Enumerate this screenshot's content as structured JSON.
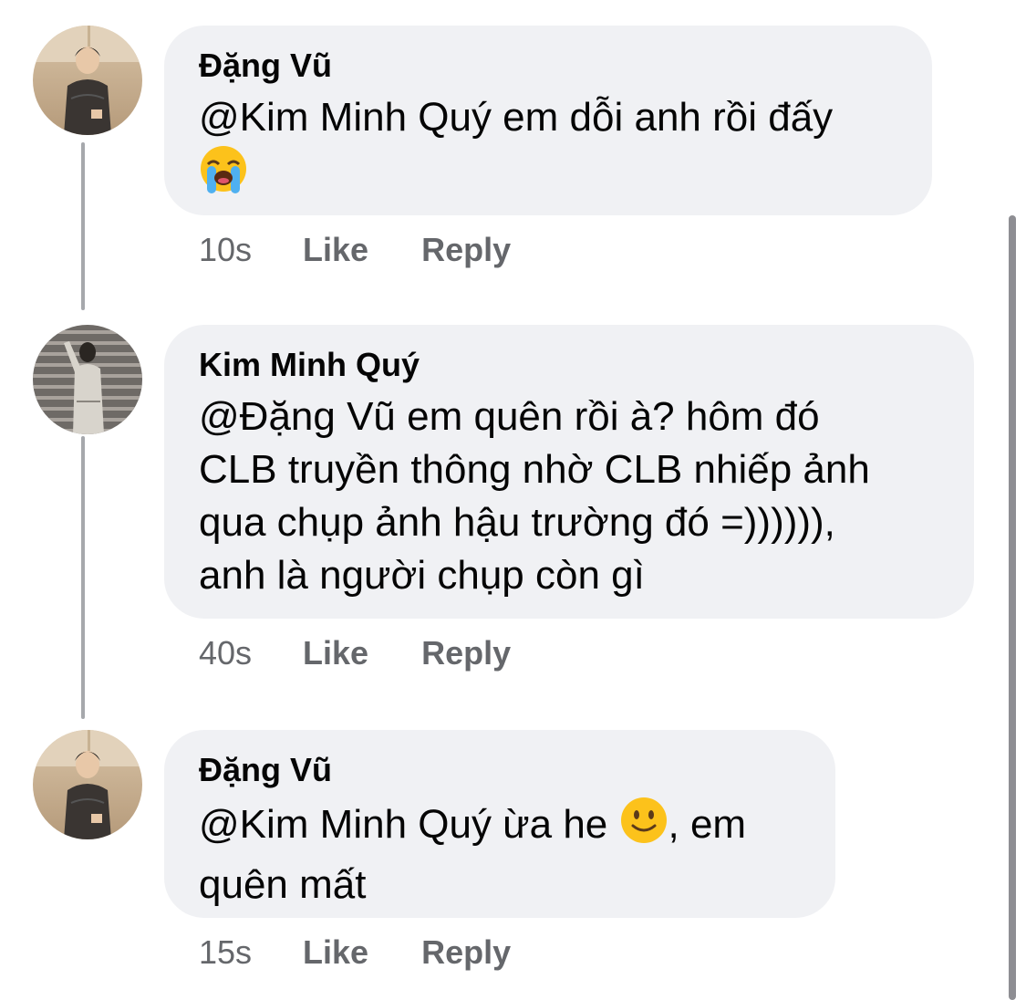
{
  "comments": [
    {
      "author": "Đặng Vũ",
      "text": "@Kim Minh Quý em dỗi anh rồi đấy",
      "emoji": "loudly-crying-face",
      "time": "10s",
      "like_label": "Like",
      "reply_label": "Reply"
    },
    {
      "author": "Kim Minh Quý",
      "text_lines": [
        "@Đặng Vũ em quên rồi à? hôm đó",
        "CLB truyền thông nhờ CLB nhiếp ảnh",
        "qua chụp ảnh hậu trường đó =)))))),",
        "anh là người chụp còn gì"
      ],
      "time": "40s",
      "like_label": "Like",
      "reply_label": "Reply"
    },
    {
      "author": "Đặng Vũ",
      "text_before_emoji": "@Kim Minh Quý ừa he ",
      "emoji": "slightly-smiling-face",
      "text_after_emoji": ", em",
      "text_line2": "quên mất",
      "time": "15s",
      "like_label": "Like",
      "reply_label": "Reply"
    }
  ],
  "colors": {
    "bubble_bg": "#f0f1f4",
    "meta_text": "#65676b",
    "thread_line": "#a6a8ac"
  }
}
